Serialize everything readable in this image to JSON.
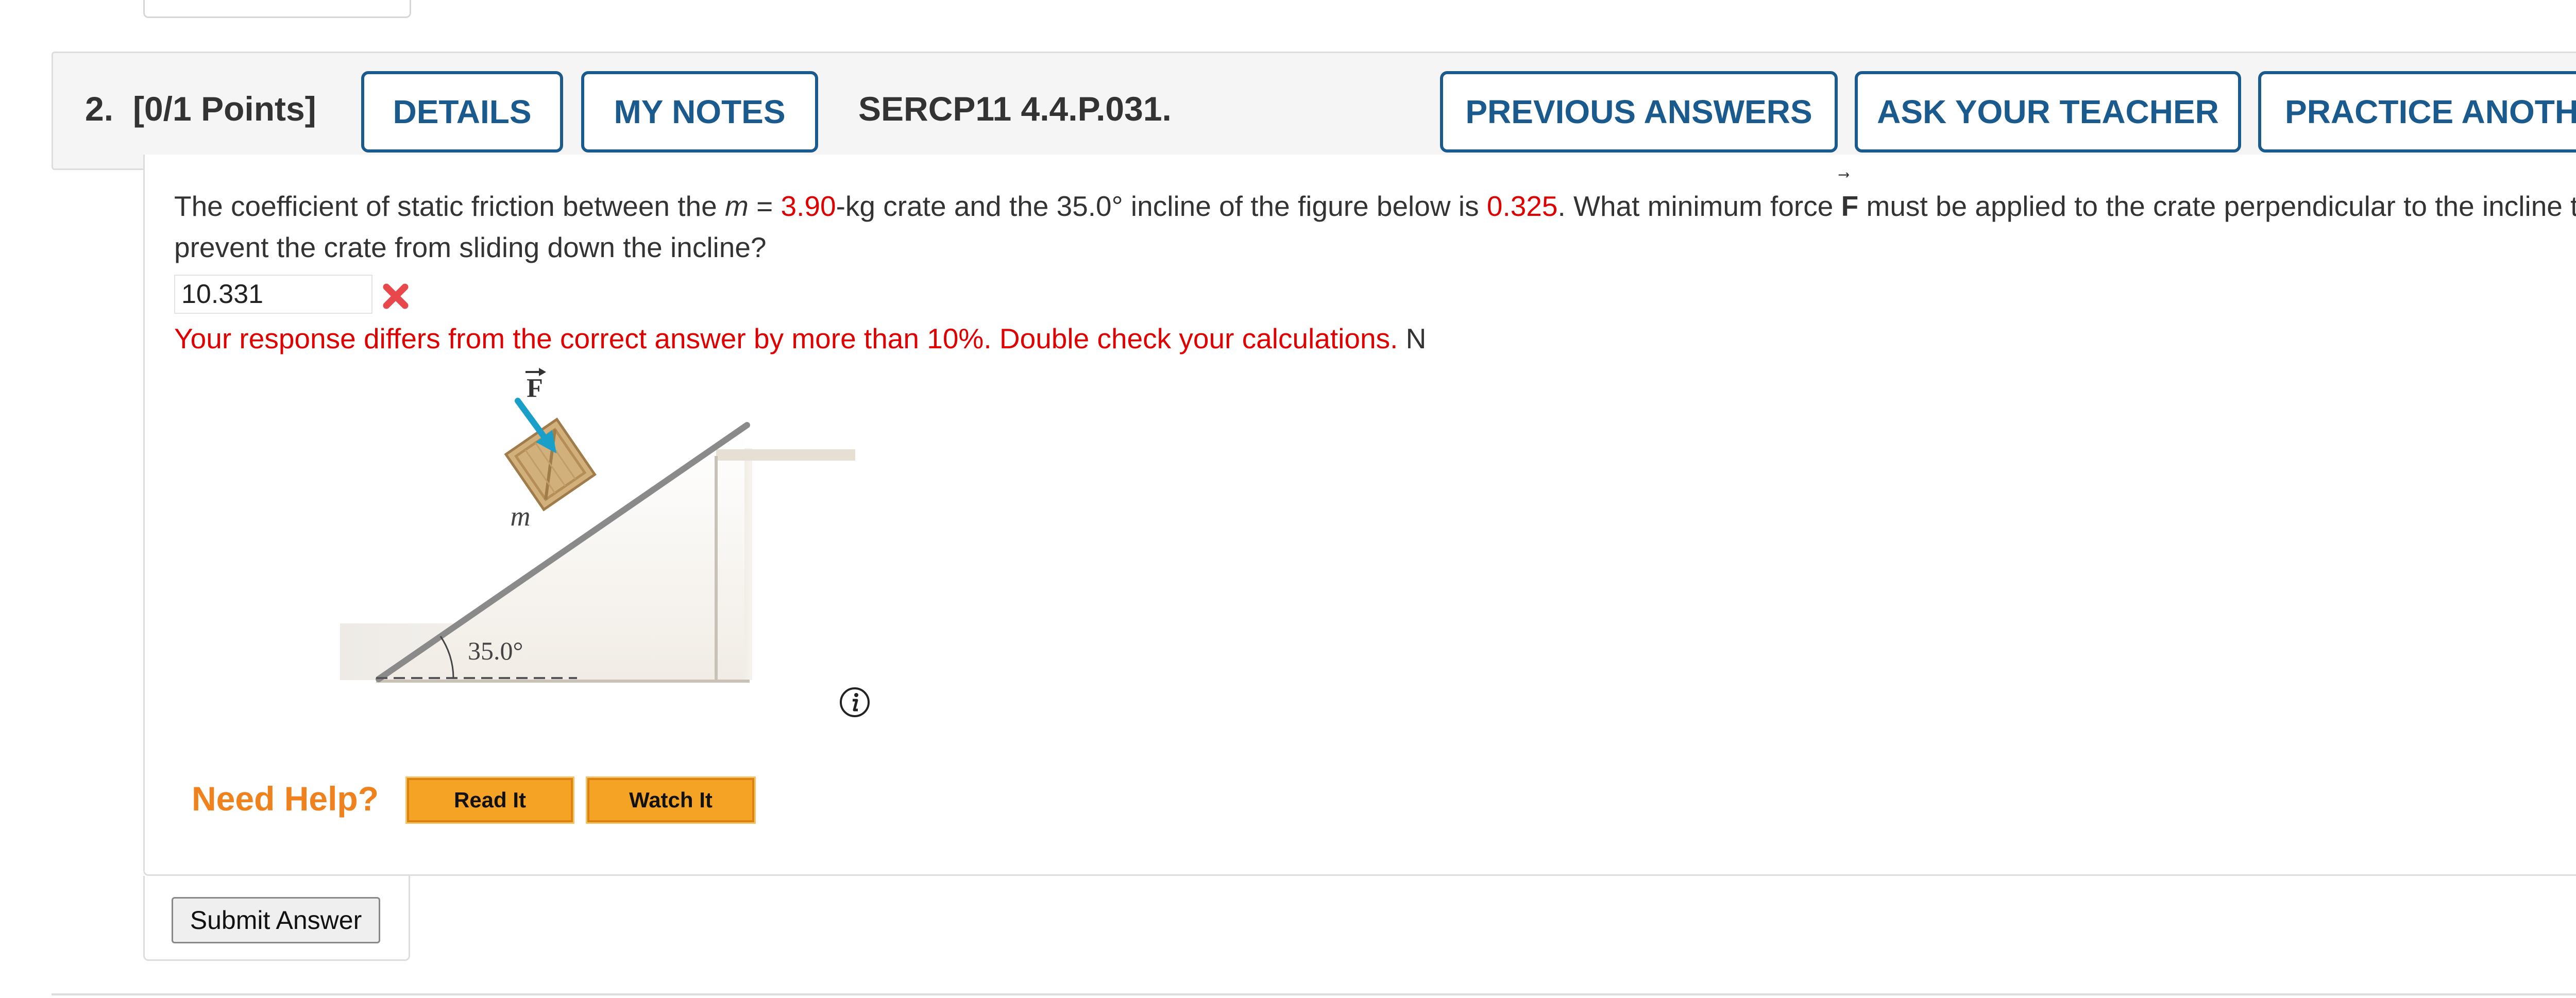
{
  "question": {
    "number": "2.",
    "points": "[0/1 Points]",
    "code": "SERCP11 4.4.P.031.",
    "buttons": {
      "details": "DETAILS",
      "my_notes": "MY NOTES",
      "previous_answers": "PREVIOUS ANSWERS",
      "ask_teacher": "ASK YOUR TEACHER",
      "practice_another": "PRACTICE ANOTHER"
    },
    "text": {
      "p1": "The coefficient of static friction between the ",
      "m": "m",
      "eq": " = ",
      "mass": "3.90",
      "p2": "-kg crate and the 35.0° incline of the figure below is ",
      "mu": "0.325",
      "p3": ". What minimum force ",
      "F": "F",
      "p4": " must be applied to the crate perpendicular to the incline to prevent the crate from sliding down the incline?"
    },
    "answer_value": "10.331",
    "feedback": "Your response differs from the correct answer by more than 10%. Double check your calculations.",
    "unit": "N",
    "figure": {
      "force_label": "F",
      "mass_label": "m",
      "angle_label": "35.0°"
    },
    "need_help": {
      "label": "Need Help?",
      "read_it": "Read It",
      "watch_it": "Watch It"
    },
    "submit": "Submit Answer"
  },
  "colors": {
    "accent": "#1b5a8d",
    "error": "#e00000",
    "help_orange": "#f0821e",
    "help_button": "#f5a324",
    "force_arrow": "#1aa0c8",
    "crate": "#d2b07c"
  }
}
